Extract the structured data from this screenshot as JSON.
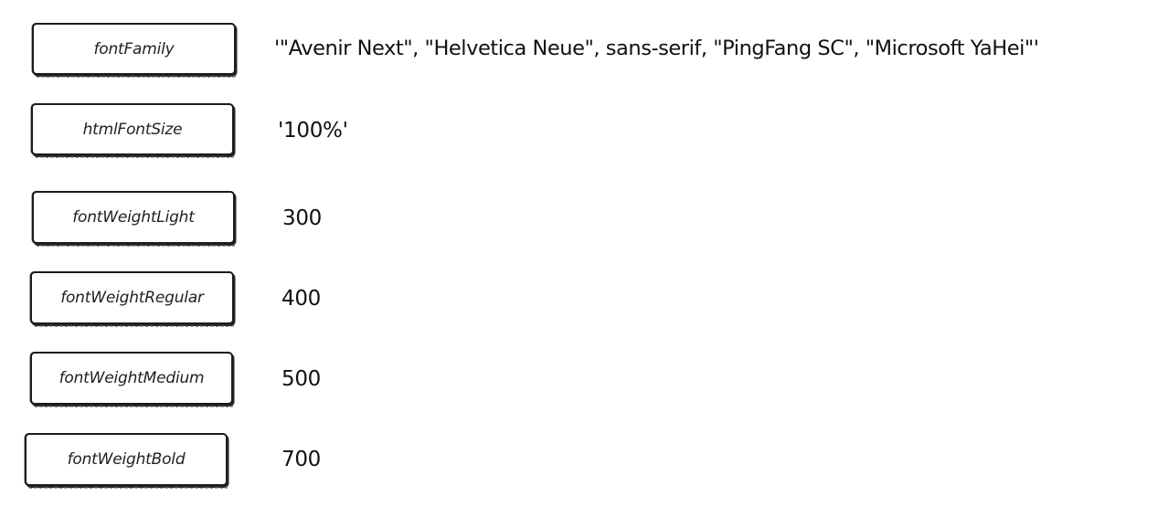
{
  "rows": [
    {
      "key": "fontFamily",
      "value": "'\"Avenir Next\", \"Helvetica Neue\", sans-serif, \"PingFang SC\", \"Microsoft YaHei\"'"
    },
    {
      "key": "htmlFontSize",
      "value": "'100%'"
    },
    {
      "key": "fontWeightLight",
      "value": "300"
    },
    {
      "key": "fontWeightRegular",
      "value": "400"
    },
    {
      "key": "fontWeightMedium",
      "value": "500"
    },
    {
      "key": "fontWeightBold",
      "value": "700"
    }
  ]
}
